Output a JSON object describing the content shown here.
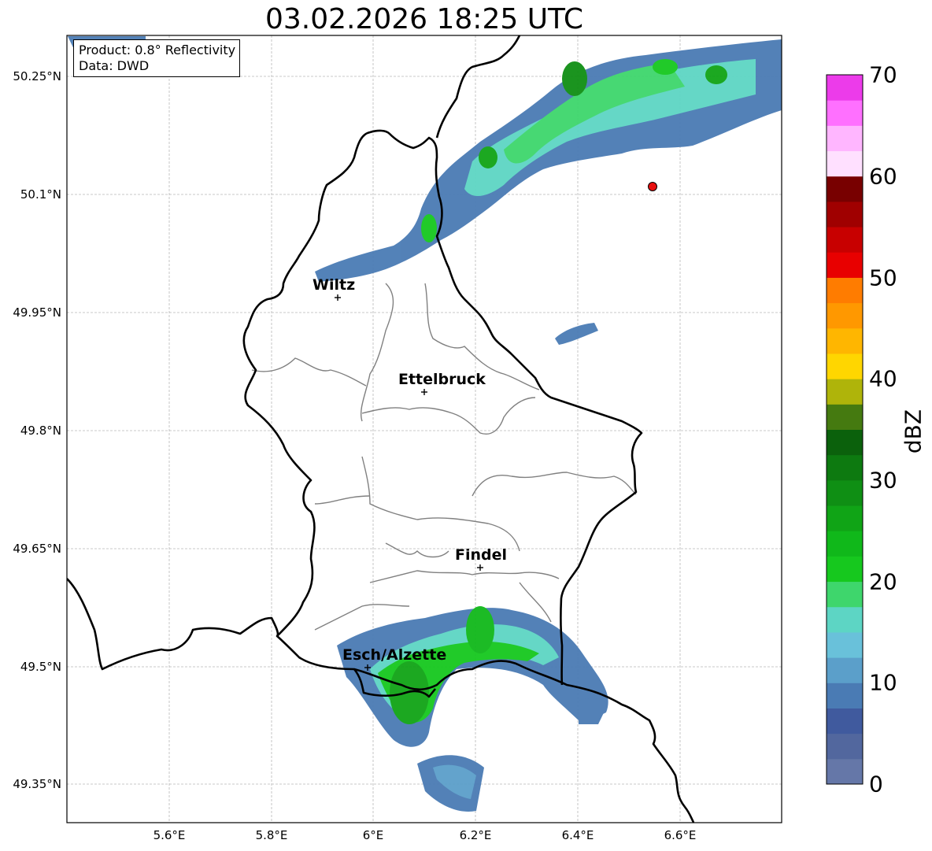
{
  "title": "03.02.2026 18:25 UTC",
  "info_box": {
    "product": "Product: 0.8° Reflectivity",
    "source": "Data: DWD"
  },
  "lat_ticks": [
    "50.25°N",
    "50.1°N",
    "49.95°N",
    "49.8°N",
    "49.65°N",
    "49.5°N",
    "49.35°N"
  ],
  "lon_ticks": [
    "5.6°E",
    "5.8°E",
    "6°E",
    "6.2°E",
    "6.4°E",
    "6.6°E"
  ],
  "colorbar": {
    "label": "dBZ",
    "ticks": [
      "0",
      "10",
      "20",
      "30",
      "40",
      "50",
      "60",
      "70"
    ],
    "colors": [
      "#6577a8",
      "#52679e",
      "#405a9e",
      "#4a7bb4",
      "#5b9fca",
      "#69c1da",
      "#5dd5c4",
      "#3ed66c",
      "#16c81e",
      "#10b81a",
      "#10a416",
      "#0f8f14",
      "#0d7a10",
      "#0b610c",
      "#457a10",
      "#afb40a",
      "#ffd600",
      "#ffb600",
      "#ff9800",
      "#ff7c00",
      "#e80000",
      "#c80000",
      "#a00000",
      "#780000",
      "#ffe0ff",
      "#ffb6ff",
      "#ff70ff",
      "#ec3bea"
    ]
  },
  "cities": [
    {
      "name": "Wiltz"
    },
    {
      "name": "Ettelbruck"
    },
    {
      "name": "Findel"
    },
    {
      "name": "Esch/Alzette"
    }
  ],
  "colors": {
    "radar_station_marker": "#e81010",
    "country_border": "#000000",
    "district_border": "#808080"
  }
}
